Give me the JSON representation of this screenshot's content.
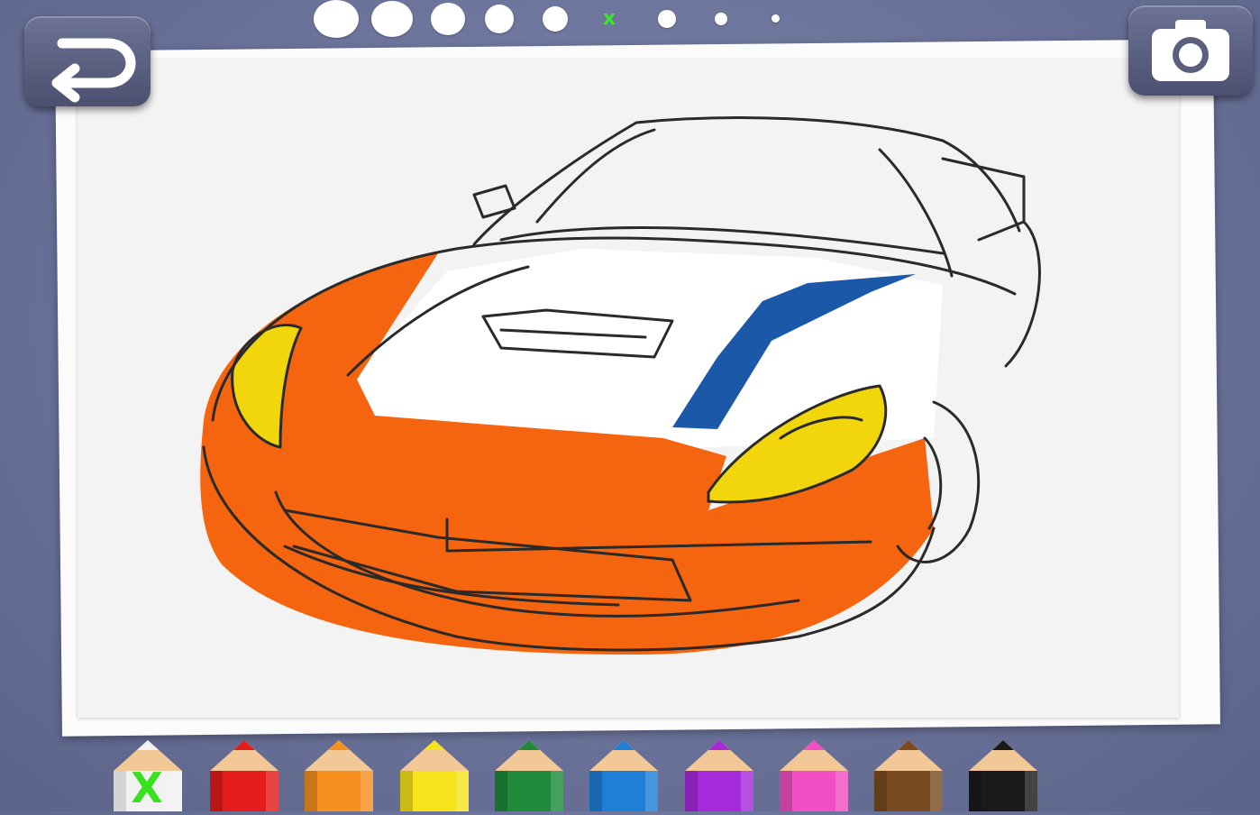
{
  "toolbar": {
    "undo_icon": "undo-arrow-icon",
    "camera_icon": "camera-icon"
  },
  "brush_sizes": {
    "selected_index": 5,
    "selected_mark": "x",
    "sizes": [
      "xx-large",
      "x-large",
      "large",
      "medium",
      "small",
      "selected",
      "x-small",
      "xx-small",
      "tiny"
    ]
  },
  "palette": {
    "eraser_mark": "X",
    "crayons": [
      {
        "name": "eraser",
        "color": "#f2f2f2"
      },
      {
        "name": "red",
        "color": "#e41c1c"
      },
      {
        "name": "orange",
        "color": "#f7901e"
      },
      {
        "name": "yellow",
        "color": "#f7e41c"
      },
      {
        "name": "green",
        "color": "#1f8a3c"
      },
      {
        "name": "blue",
        "color": "#1d7fd6"
      },
      {
        "name": "purple",
        "color": "#a62ad9"
      },
      {
        "name": "pink",
        "color": "#f24fc4"
      },
      {
        "name": "brown",
        "color": "#7a4b22"
      },
      {
        "name": "black",
        "color": "#1a1a1a"
      }
    ]
  },
  "drawing": {
    "subject": "car-line-art",
    "fill_colors": {
      "body": "#f5640f",
      "stripe": "#1b58a8",
      "headlights": "#f1d60c"
    }
  }
}
